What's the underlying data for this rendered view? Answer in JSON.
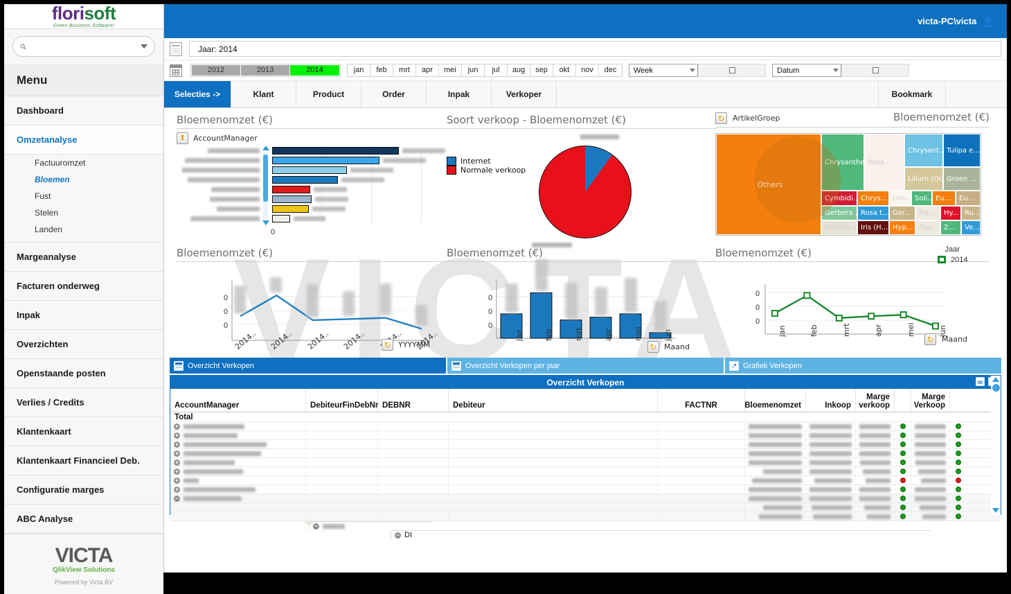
{
  "brand": {
    "logo_primary": "flori",
    "logo_secondary": "soft",
    "logo_tagline": "Green Business Software!"
  },
  "search": {
    "value": "",
    "placeholder": ""
  },
  "sidebar": {
    "menu_title": "Menu",
    "items": [
      {
        "label": "Dashboard",
        "active": false
      },
      {
        "label": "Omzetanalyse",
        "active": true
      },
      {
        "label": "Margeanalyse",
        "active": false
      },
      {
        "label": "Facturen onderweg",
        "active": false
      },
      {
        "label": "Inpak",
        "active": false
      },
      {
        "label": "Overzichten",
        "active": false
      },
      {
        "label": "Openstaande posten",
        "active": false
      },
      {
        "label": "Verlies / Credits",
        "active": false
      },
      {
        "label": "Klantenkaart",
        "active": false
      },
      {
        "label": "Klantenkaart Financieel Deb.",
        "active": false
      },
      {
        "label": "Configuratie marges",
        "active": false
      },
      {
        "label": "ABC Analyse",
        "active": false
      }
    ],
    "subitems": [
      {
        "label": "Factuuromzet",
        "active": false
      },
      {
        "label": "Bloemen",
        "active": true
      },
      {
        "label": "Fust",
        "active": false
      },
      {
        "label": "Stelen",
        "active": false
      },
      {
        "label": "Landen",
        "active": false
      }
    ],
    "footer": {
      "logo": "VICTA",
      "logo_sub": "QlikView Solutions",
      "powered": "Powered by Victa BV"
    }
  },
  "header": {
    "user": "victa-PC\\victa"
  },
  "filters": {
    "current_selection": "Jaar: 2014",
    "years": [
      {
        "label": "2012",
        "selected": false
      },
      {
        "label": "2013",
        "selected": false
      },
      {
        "label": "2014",
        "selected": true
      }
    ],
    "months": [
      "jan",
      "feb",
      "mrt",
      "apr",
      "mei",
      "jun",
      "jul",
      "aug",
      "sep",
      "okt",
      "nov",
      "dec"
    ],
    "week_dropdown": "Week",
    "week_value": "",
    "datum_dropdown": "Datum",
    "datum_value": ""
  },
  "tabs": [
    {
      "label": "Selecties ->",
      "selected": true
    },
    {
      "label": "Klant",
      "selected": false
    },
    {
      "label": "Product",
      "selected": false
    },
    {
      "label": "Order",
      "selected": false
    },
    {
      "label": "Inpak",
      "selected": false
    },
    {
      "label": "Verkoper",
      "selected": false
    },
    {
      "label": "Bookmark",
      "selected": false
    }
  ],
  "charts": {
    "accountmanager_bar": {
      "title": "Bloemenomzet (€)",
      "dimension": "AccountManager",
      "axis_zero": "0"
    },
    "soort_pie": {
      "title": "Soort verkoop - Bloemenomzet (€)",
      "legend": [
        "Internet",
        "Normale verkoop"
      ]
    },
    "treemap": {
      "title": "Bloemenomzet (€)",
      "dimension": "ArtikelGroep"
    },
    "yyyymm_line": {
      "title": "Bloemenomzet (€)",
      "x_axis_label": "YYYYMM",
      "axis_ticks": [
        "0",
        "0",
        "0"
      ]
    },
    "maand_column": {
      "title": "Bloemenomzet (€)",
      "x_axis_label": "Maand",
      "axis_ticks": [
        "0",
        "0",
        "0"
      ]
    },
    "jaar_line": {
      "title": "Bloemenomzet (€)",
      "x_axis_label": "Maand",
      "legend_title": "Jaar",
      "legend_value": "2014",
      "axis_ticks": [
        "0",
        "0",
        "0"
      ]
    }
  },
  "chart_data": [
    {
      "type": "bar",
      "orientation": "horizontal",
      "title": "Bloemenomzet (€)",
      "xlabel": "",
      "ylabel": "AccountManager",
      "categories": [
        "",
        "",
        "",
        "",
        "",
        "",
        "",
        ""
      ],
      "values": [
        100,
        85,
        59,
        52,
        30,
        31,
        29,
        14
      ],
      "colors": [
        "#12375f",
        "#3aa6e8",
        "#8ecde9",
        "#1a78bf",
        "#e01b1b",
        "#9db6cd",
        "#eec61a",
        "#f0eeea"
      ],
      "xlim": [
        0,
        115
      ],
      "grid": true,
      "legend": "none"
    },
    {
      "type": "pie",
      "title": "Soort verkoop - Bloemenomzet (€)",
      "categories": [
        "Internet",
        "Normale verkoop"
      ],
      "values": [
        10,
        90
      ],
      "colors": [
        "#1a78bf",
        "#e8111b"
      ],
      "legend": "left"
    },
    {
      "type": "heatmap",
      "subtype": "treemap",
      "title": "Bloemenomzet (€)",
      "dimension": "ArtikelGroep",
      "cells": [
        {
          "label": "Others",
          "value": 100,
          "color": "#f57f0c"
        },
        {
          "label": "Chrysanthe...",
          "value": 19,
          "color": "#4fb97c"
        },
        {
          "label": "Rosa ...",
          "value": 14,
          "color": "#fbf0ec"
        },
        {
          "label": "Chrysant...",
          "value": 9,
          "color": "#6ec2e4"
        },
        {
          "label": "Tulipa e...",
          "value": 9,
          "color": "#0d72bb"
        },
        {
          "label": "Lilium (Or...",
          "value": 6,
          "color": "#d4c79a"
        },
        {
          "label": "Groen ...",
          "value": 5,
          "color": "#a9b49a"
        },
        {
          "label": "Cymbidi...",
          "value": 4,
          "color": "#d01c33"
        },
        {
          "label": "Chrys...",
          "value": 4,
          "color": "#f57f0c"
        },
        {
          "label": "Lim...",
          "value": 3,
          "color": "#fbf6f0"
        },
        {
          "label": "Soli...",
          "value": 3,
          "color": "#4fb97c"
        },
        {
          "label": "Eu...",
          "value": 3,
          "color": "#f57f0c"
        },
        {
          "label": "Eu...",
          "value": 3,
          "color": "#c6ad84"
        },
        {
          "label": "Gerbera ...",
          "value": 3,
          "color": "#7fc79b"
        },
        {
          "label": "Rosa t...",
          "value": 3,
          "color": "#2f9bd8"
        },
        {
          "label": "Ger...",
          "value": 2,
          "color": "#c8b489"
        },
        {
          "label": "Fre...",
          "value": 2,
          "color": "#efe9de"
        },
        {
          "label": "Hy...",
          "value": 2,
          "color": "#e01028"
        },
        {
          "label": "Ru...",
          "value": 2,
          "color": "#c8b489"
        },
        {
          "label": "Groenb...",
          "value": 2,
          "color": "#e6e2d6"
        },
        {
          "label": "Iris (H...",
          "value": 2,
          "color": "#63100f"
        },
        {
          "label": "Hyp...",
          "value": 2,
          "color": "#f57f0c"
        },
        {
          "label": "Gyp...",
          "value": 2,
          "color": "#efe9de"
        },
        {
          "label": "2...",
          "value": 2,
          "color": "#4fb97c"
        },
        {
          "label": "Ve...",
          "value": 2,
          "color": "#2f9bd8"
        }
      ]
    },
    {
      "type": "line",
      "title": "Bloemenomzet (€)",
      "xlabel": "YYYYMM",
      "ylabel": "",
      "categories": [
        "2014..",
        "2014..",
        "2014..",
        "2014..",
        "2014..",
        "2014.."
      ],
      "values": [
        42,
        78,
        35,
        37,
        39,
        20
      ],
      "color": "#1f7fc4",
      "ylim": [
        0,
        100
      ],
      "grid": true
    },
    {
      "type": "bar",
      "orientation": "vertical",
      "title": "Bloemenomzet (€)",
      "xlabel": "Maand",
      "categories": [
        "jan",
        "feb",
        "mrt",
        "apr",
        "mei",
        "jun"
      ],
      "values": [
        44,
        82,
        33,
        38,
        44,
        10
      ],
      "color": "#1a78bf",
      "ylim": [
        0,
        100
      ],
      "grid": true
    },
    {
      "type": "line",
      "title": "Bloemenomzet (€)",
      "xlabel": "Maand",
      "categories": [
        "jan",
        "feb",
        "mrt",
        "apr",
        "mei",
        "jun"
      ],
      "series": [
        {
          "name": "2014",
          "values": [
            44,
            82,
            34,
            38,
            41,
            17
          ]
        }
      ],
      "color": "#198a2e",
      "ylim": [
        0,
        100
      ],
      "grid": true,
      "legend": "top-right"
    }
  ],
  "table_section": {
    "tabs": [
      {
        "label": "Overzicht Verkopen",
        "selected": true,
        "icon": "table-icon"
      },
      {
        "label": "Overzicht Verkopen per jaar",
        "selected": false,
        "icon": "table-icon"
      },
      {
        "label": "Grafiek Verkopen",
        "selected": false,
        "icon": "chart-icon"
      }
    ],
    "title": "Overzicht Verkopen",
    "columns": [
      "AccountManager",
      "DebiteurFinDebNr",
      "DEBNR",
      "Debiteur",
      "FACTNR",
      "Bloemenomzet",
      "Inkoop",
      "Marge verkoop",
      "",
      "Marge Verkoop",
      ""
    ],
    "total_label": "Total",
    "rows": [
      {
        "expander": "+",
        "status": "green"
      },
      {
        "expander": "+",
        "status": "green"
      },
      {
        "expander": "+",
        "status": "green"
      },
      {
        "expander": "+",
        "status": "green"
      },
      {
        "expander": "+",
        "status": "green"
      },
      {
        "expander": "+",
        "status": "green"
      },
      {
        "expander": "+",
        "status": "red"
      },
      {
        "expander": "+",
        "status": "green"
      },
      {
        "expander": "-",
        "status": "green"
      },
      {
        "expander": "-",
        "status": "green"
      },
      {
        "expander": "-",
        "status": "green"
      }
    ],
    "sub_rows": [
      {
        "expander": "-",
        "label": ""
      },
      {
        "expander": "-",
        "label": "DI"
      }
    ]
  }
}
